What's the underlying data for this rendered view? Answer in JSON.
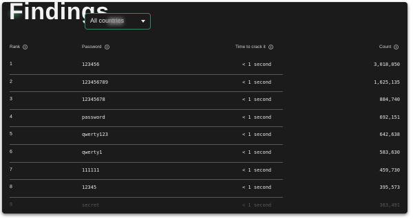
{
  "page": {
    "title": "Findings"
  },
  "filter": {
    "country_select_value": "All countries",
    "caret_icon": "chevron-down-icon"
  },
  "table": {
    "headers": {
      "rank": "Rank",
      "password": "Password",
      "time": "Time to crack it",
      "count": "Count"
    },
    "info_icon": "info-icon",
    "rows": [
      {
        "rank": "1",
        "password": "123456",
        "time": "< 1 second",
        "count": "3,018,050"
      },
      {
        "rank": "2",
        "password": "123456789",
        "time": "< 1 second",
        "count": "1,625,135"
      },
      {
        "rank": "3",
        "password": "12345678",
        "time": "< 1 second",
        "count": "884,740"
      },
      {
        "rank": "4",
        "password": "password",
        "time": "< 1 second",
        "count": "692,151"
      },
      {
        "rank": "5",
        "password": "qwerty123",
        "time": "< 1 second",
        "count": "642,638"
      },
      {
        "rank": "6",
        "password": "qwerty1",
        "time": "< 1 second",
        "count": "583,630"
      },
      {
        "rank": "7",
        "password": "111111",
        "time": "< 1 second",
        "count": "459,730"
      },
      {
        "rank": "8",
        "password": "12345",
        "time": "< 1 second",
        "count": "395,573"
      },
      {
        "rank": "9",
        "password": "secret",
        "time": "< 1 second",
        "count": "363,491"
      }
    ]
  },
  "colors": {
    "background": "#1b1b1c",
    "accent_border": "#2f8b62",
    "divider": "#5a5a5c",
    "text": "#e4e4e4"
  }
}
